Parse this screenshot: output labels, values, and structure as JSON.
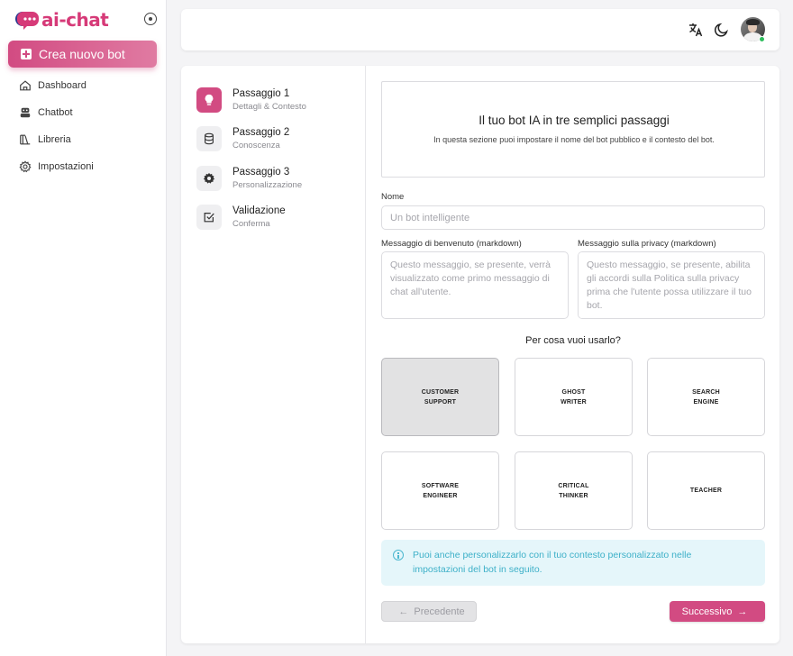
{
  "app": {
    "logo_text": "ai-chat",
    "brand_color": "#d24b82"
  },
  "sidebar": {
    "new_bot_label": "Crea nuovo bot",
    "items": [
      {
        "label": "Dashboard",
        "icon": "home-icon"
      },
      {
        "label": "Chatbot",
        "icon": "bot-icon"
      },
      {
        "label": "Libreria",
        "icon": "library-icon"
      },
      {
        "label": "Impostazioni",
        "icon": "gear-icon"
      }
    ]
  },
  "header": {
    "icons": [
      "translate-icon",
      "moon-icon"
    ],
    "user_status": "online"
  },
  "steps": [
    {
      "title": "Passaggio 1",
      "subtitle": "Dettagli & Contesto",
      "icon": "lightbulb-icon",
      "active": true
    },
    {
      "title": "Passaggio 2",
      "subtitle": "Conoscenza",
      "icon": "database-icon",
      "active": false
    },
    {
      "title": "Passaggio 3",
      "subtitle": "Personalizzazione",
      "icon": "gear-icon",
      "active": false
    },
    {
      "title": "Validazione",
      "subtitle": "Conferma",
      "icon": "checkbox-icon",
      "active": false
    }
  ],
  "intro": {
    "title": "Il tuo bot IA in tre semplici passaggi",
    "subtitle": "In questa sezione puoi impostare il nome del bot pubblico e il contesto del bot."
  },
  "form": {
    "name_label": "Nome",
    "name_placeholder": "Un bot intelligente",
    "name_value": "",
    "welcome_label": "Messaggio di benvenuto (markdown)",
    "welcome_placeholder": "Questo messaggio, se presente, verrà visualizzato come primo messaggio di chat all'utente.",
    "privacy_label": "Messaggio sulla privacy (markdown)",
    "privacy_placeholder": "Questo messaggio, se presente, abilita gli accordi sulla Politica sulla privacy prima che l'utente possa utilizzare il tuo bot."
  },
  "use_case": {
    "title": "Per cosa vuoi usarlo?",
    "options": [
      {
        "label": "CUSTOMER\nSUPPORT",
        "selected": true
      },
      {
        "label": "GHOST\nWRITER",
        "selected": false
      },
      {
        "label": "SEARCH\nENGINE",
        "selected": false
      },
      {
        "label": "SOFTWARE\nENGINEER",
        "selected": false
      },
      {
        "label": "CRITICAL\nTHINKER",
        "selected": false
      },
      {
        "label": "TEACHER",
        "selected": false
      }
    ]
  },
  "info_text": "Puoi anche personalizzarlo con il tuo contesto personalizzato nelle impostazioni del bot in seguito.",
  "nav_buttons": {
    "prev_label": "Precedente",
    "next_label": "Successivo"
  }
}
